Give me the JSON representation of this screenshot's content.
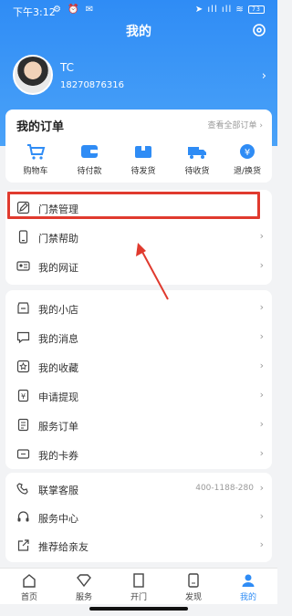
{
  "status": {
    "time": "下午3:12",
    "left_icons": "⚙ ⏰ ✉",
    "right_icons": "➤ ıll ıll ≋",
    "battery": "73"
  },
  "header": {
    "title": "我的",
    "user_name": "TC",
    "user_phone": "18270876316"
  },
  "orders": {
    "title": "我的订单",
    "view_all": "查看全部订单 ›",
    "items": [
      {
        "label": "购物车",
        "icon": "cart-icon"
      },
      {
        "label": "待付款",
        "icon": "wallet-icon"
      },
      {
        "label": "待发货",
        "icon": "package-icon"
      },
      {
        "label": "待收货",
        "icon": "truck-icon"
      },
      {
        "label": "退/换货",
        "icon": "refund-icon"
      }
    ]
  },
  "menu_group1": [
    {
      "label": "门禁管理",
      "icon": "edit-icon"
    },
    {
      "label": "门禁帮助",
      "icon": "phone-icon"
    },
    {
      "label": "我的网证",
      "icon": "id-card-icon"
    }
  ],
  "menu_group2": [
    {
      "label": "我的小店",
      "icon": "shop-icon"
    },
    {
      "label": "我的消息",
      "icon": "message-icon"
    },
    {
      "label": "我的收藏",
      "icon": "star-icon"
    },
    {
      "label": "申请提现",
      "icon": "withdraw-icon"
    },
    {
      "label": "服务订单",
      "icon": "order-list-icon"
    },
    {
      "label": "我的卡券",
      "icon": "coupon-icon"
    }
  ],
  "menu_group3": [
    {
      "label": "联掌客服",
      "icon": "headset-phone-icon",
      "value": "400-1188-280"
    },
    {
      "label": "服务中心",
      "icon": "headset-icon"
    },
    {
      "label": "推荐给亲友",
      "icon": "share-icon"
    }
  ],
  "arrow": "›",
  "tabs": [
    {
      "label": "首页",
      "icon": "home-icon"
    },
    {
      "label": "服务",
      "icon": "diamond-icon"
    },
    {
      "label": "开门",
      "icon": "door-icon"
    },
    {
      "label": "发现",
      "icon": "discover-icon"
    },
    {
      "label": "我的",
      "icon": "profile-icon"
    }
  ],
  "colors": {
    "primary": "#2f8cf5",
    "highlight": "#e03a2e"
  }
}
